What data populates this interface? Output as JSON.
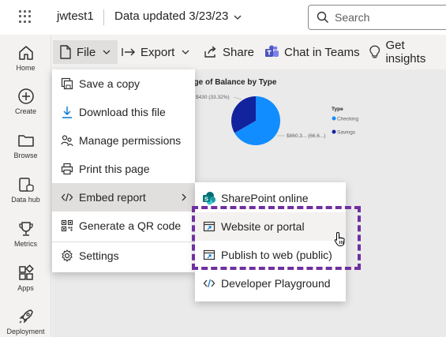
{
  "header": {
    "workspace": "jwtest1",
    "data_updated": "Data updated 3/23/23",
    "search_placeholder": "Search"
  },
  "leftnav": {
    "items": [
      {
        "label": "Home",
        "icon": "home-icon"
      },
      {
        "label": "Create",
        "icon": "plus-circle-icon"
      },
      {
        "label": "Browse",
        "icon": "folder-icon"
      },
      {
        "label": "Data hub",
        "icon": "database-icon"
      },
      {
        "label": "Metrics",
        "icon": "trophy-icon"
      },
      {
        "label": "Apps",
        "icon": "apps-icon"
      },
      {
        "label": "Deployment",
        "icon": "rocket-icon"
      }
    ]
  },
  "commandbar": {
    "file": "File",
    "export": "Export",
    "share": "Share",
    "chat": "Chat in Teams",
    "insights": "Get insights"
  },
  "file_menu": {
    "items": [
      {
        "label": "Save a copy",
        "icon": "save-copy-icon"
      },
      {
        "label": "Download this file",
        "icon": "download-icon"
      },
      {
        "label": "Manage permissions",
        "icon": "people-icon"
      },
      {
        "label": "Print this page",
        "icon": "print-icon"
      },
      {
        "label": "Embed report",
        "icon": "code-icon"
      },
      {
        "label": "Generate a QR code",
        "icon": "qr-code-icon"
      },
      {
        "label": "Settings",
        "icon": "gear-icon"
      }
    ]
  },
  "embed_submenu": {
    "items": [
      {
        "label": "SharePoint online",
        "icon": "sharepoint-icon"
      },
      {
        "label": "Website or portal",
        "icon": "browser-icon"
      },
      {
        "label": "Publish to web (public)",
        "icon": "browser-icon"
      },
      {
        "label": "Developer Playground",
        "icon": "code-icon"
      }
    ]
  },
  "colors": {
    "highlight": "#7030a0",
    "checking": "#118dff",
    "savings": "#12239e"
  },
  "chart_data": {
    "type": "pie",
    "title": "age of Balance by Type",
    "legend_title": "Type",
    "legend_position": "right",
    "categories": [
      "Checking",
      "Savings"
    ],
    "values": [
      860.3,
      430
    ],
    "labels": [
      "$860.3... (66.6...)",
      "$430 (33.32%)"
    ]
  }
}
